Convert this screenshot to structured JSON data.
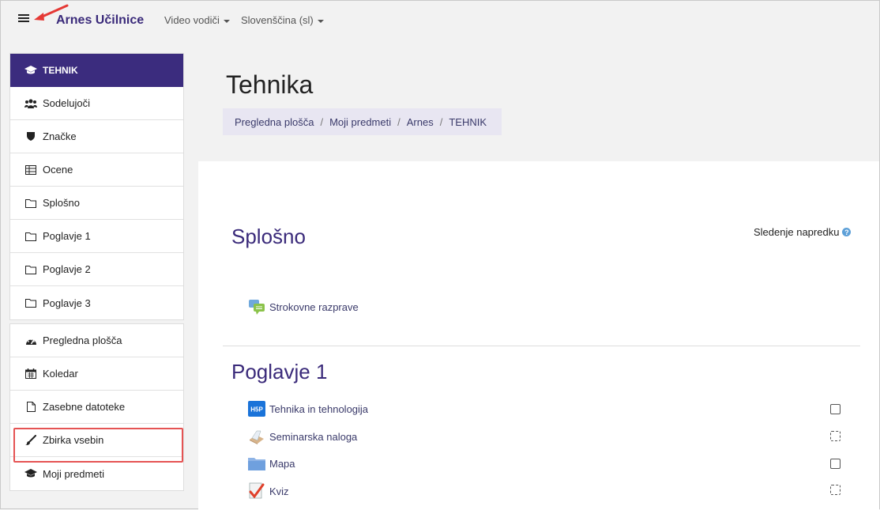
{
  "header": {
    "brand": "Arnes Učilnice",
    "menu": [
      {
        "label": "Video vodiči"
      },
      {
        "label": "Slovenščina (sl)"
      }
    ]
  },
  "sidebar": {
    "course_items": [
      {
        "label": "TEHNIK",
        "icon": "graduation-cap-icon"
      },
      {
        "label": "Sodelujoči",
        "icon": "users-icon"
      },
      {
        "label": "Značke",
        "icon": "shield-icon"
      },
      {
        "label": "Ocene",
        "icon": "table-icon"
      },
      {
        "label": "Splošno",
        "icon": "folder-icon"
      },
      {
        "label": "Poglavje 1",
        "icon": "folder-icon"
      },
      {
        "label": "Poglavje 2",
        "icon": "folder-icon"
      },
      {
        "label": "Poglavje 3",
        "icon": "folder-icon"
      }
    ],
    "site_items": [
      {
        "label": "Pregledna plošča",
        "icon": "dashboard-icon"
      },
      {
        "label": "Koledar",
        "icon": "calendar-icon"
      },
      {
        "label": "Zasebne datoteke",
        "icon": "file-icon"
      },
      {
        "label": "Zbirka vsebin",
        "icon": "paintbrush-icon"
      },
      {
        "label": "Moji predmeti",
        "icon": "graduation-cap-icon"
      }
    ]
  },
  "main": {
    "title": "Tehnika",
    "breadcrumb": [
      "Pregledna plošča",
      "Moji predmeti",
      "Arnes",
      "TEHNIK"
    ],
    "tracking_label": "Sledenje napredku",
    "sections": [
      {
        "title": "Splošno",
        "activities": [
          {
            "label": "Strokovne razprave",
            "icon": "forum-icon"
          }
        ]
      },
      {
        "title": "Poglavje 1",
        "activities": [
          {
            "label": "Tehnika in tehnologija",
            "icon": "h5p-icon",
            "completion": "manual"
          },
          {
            "label": "Seminarska naloga",
            "icon": "assignment-icon",
            "completion": "auto"
          },
          {
            "label": "Mapa",
            "icon": "folder-icon",
            "completion": "manual"
          },
          {
            "label": "Kviz",
            "icon": "quiz-icon",
            "completion": "auto"
          }
        ]
      }
    ]
  },
  "colors": {
    "brand": "#3b2c7e",
    "highlight": "#e55353"
  }
}
